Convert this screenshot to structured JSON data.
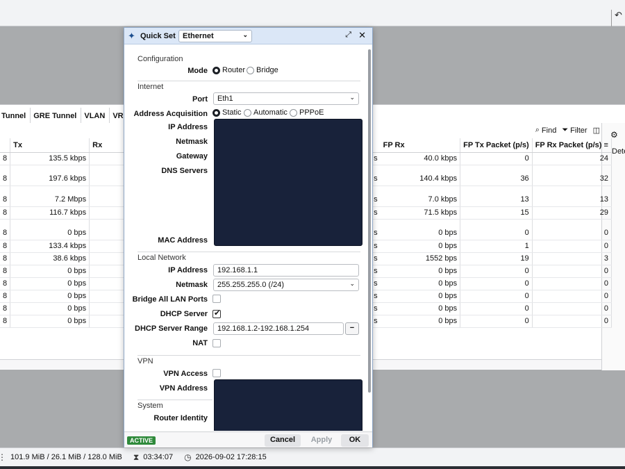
{
  "topbar": {
    "undo_icon": "undo-icon"
  },
  "background": {
    "tabs": [
      "Tunnel",
      "GRE Tunnel",
      "VLAN",
      "VRR"
    ],
    "tools": {
      "find": "Find",
      "filter": "Filter"
    },
    "side_panel": {
      "label": "Dete",
      "icon_glyph": "C"
    },
    "left_columns": [
      "Tx",
      "Rx"
    ],
    "right_columns": [
      "FP Rx",
      "FP Tx Packet (p/s)",
      "FP Rx Packet (p/s)"
    ],
    "rows": [
      {
        "pre": "8",
        "tx": "135.5 kbps",
        "mid": "s",
        "fp_rx": "40.0 kbps",
        "fp_tx_p": "0",
        "fp_rx_p": "24"
      },
      {
        "pre": "8",
        "tx": "197.6 kbps",
        "mid": "s",
        "fp_rx": "140.4 kbps",
        "fp_tx_p": "36",
        "fp_rx_p": "32"
      },
      {
        "pre": "8",
        "tx": "7.2 Mbps",
        "mid": "s",
        "fp_rx": "7.0 kbps",
        "fp_tx_p": "13",
        "fp_rx_p": "13"
      },
      {
        "pre": "8",
        "tx": "116.7 kbps",
        "mid": "s",
        "fp_rx": "71.5 kbps",
        "fp_tx_p": "15",
        "fp_rx_p": "29"
      },
      {
        "pre": "8",
        "tx": "0 bps",
        "mid": "s",
        "fp_rx": "0 bps",
        "fp_tx_p": "0",
        "fp_rx_p": "0"
      },
      {
        "pre": "8",
        "tx": "133.4 kbps",
        "mid": "s",
        "fp_rx": "0 bps",
        "fp_tx_p": "1",
        "fp_rx_p": "0"
      },
      {
        "pre": "8",
        "tx": "38.6 kbps",
        "mid": "s",
        "fp_rx": "1552 bps",
        "fp_tx_p": "19",
        "fp_rx_p": "3"
      },
      {
        "pre": "8",
        "tx": "0 bps",
        "mid": "s",
        "fp_rx": "0 bps",
        "fp_tx_p": "0",
        "fp_rx_p": "0"
      },
      {
        "pre": "8",
        "tx": "0 bps",
        "mid": "s",
        "fp_rx": "0 bps",
        "fp_tx_p": "0",
        "fp_rx_p": "0"
      },
      {
        "pre": "8",
        "tx": "0 bps",
        "mid": "s",
        "fp_rx": "0 bps",
        "fp_tx_p": "0",
        "fp_rx_p": "0"
      },
      {
        "pre": "8",
        "tx": "0 bps",
        "mid": "s",
        "fp_rx": "0 bps",
        "fp_tx_p": "0",
        "fp_rx_p": "0"
      },
      {
        "pre": "8",
        "tx": "0 bps",
        "mid": "s",
        "fp_rx": "0 bps",
        "fp_tx_p": "0",
        "fp_rx_p": "0"
      }
    ]
  },
  "dialog": {
    "title": "Quick Set",
    "mode_select": "Ethernet",
    "sections": {
      "configuration": "Configuration",
      "internet": "Internet",
      "local_network": "Local Network",
      "vpn": "VPN",
      "system": "System"
    },
    "mode": {
      "label": "Mode",
      "options": [
        "Router",
        "Bridge"
      ],
      "selected": "Router"
    },
    "port": {
      "label": "Port",
      "value": "Eth1"
    },
    "address_acquisition": {
      "label": "Address Acquisition",
      "options": [
        "Static",
        "Automatic",
        "PPPoE"
      ],
      "selected": "Static"
    },
    "internet_labels": {
      "ip": "IP Address",
      "netmask": "Netmask",
      "gateway": "Gateway",
      "dns": "DNS Servers",
      "mac": "MAC Address"
    },
    "lan": {
      "ip_label": "IP Address",
      "ip_value": "192.168.1.1",
      "netmask_label": "Netmask",
      "netmask_value": "255.255.255.0 (/24)",
      "bridge_label": "Bridge All LAN Ports",
      "bridge_checked": false,
      "dhcp_label": "DHCP Server",
      "dhcp_checked": true,
      "range_label": "DHCP Server Range",
      "range_value": "192.168.1.2-192.168.1.254",
      "nat_label": "NAT",
      "nat_checked": false
    },
    "vpn_labels": {
      "access": "VPN Access",
      "address": "VPN Address"
    },
    "system_labels": {
      "identity": "Router Identity"
    },
    "footer": {
      "badge": "ACTIVE",
      "cancel": "Cancel",
      "apply": "Apply",
      "ok": "OK"
    },
    "colors": {
      "redacted": "#18223a",
      "badge": "#2f8a3b",
      "header": "#dbe7f7"
    }
  },
  "statusbar": {
    "memory": "101.9 MiB / 26.1 MiB / 128.0 MiB",
    "uptime": "03:34:07",
    "datetime": "2026-09-02 17:28:15"
  }
}
